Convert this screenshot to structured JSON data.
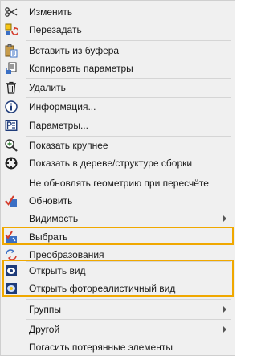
{
  "menu": {
    "accent_color": "#f0a800",
    "items": [
      {
        "label": "Изменить",
        "icon": "scissors-edit-icon"
      },
      {
        "label": "Перезадать",
        "icon": "redefine-icon"
      },
      {
        "label": "Вставить из буфера",
        "icon": "clipboard-paste-icon"
      },
      {
        "label": "Копировать параметры",
        "icon": "copy-params-icon"
      },
      {
        "label": "Удалить",
        "icon": "trash-icon"
      },
      {
        "label": "Информация...",
        "icon": "info-icon"
      },
      {
        "label": "Параметры...",
        "icon": "parameters-icon"
      },
      {
        "label": "Показать крупнее",
        "icon": "zoom-in-icon"
      },
      {
        "label": "Показать в дереве/структуре сборки",
        "icon": "crosshair-icon"
      },
      {
        "label": "Не обновлять геометрию при пересчёте",
        "icon": ""
      },
      {
        "label": "Обновить",
        "icon": "refresh-check-icon"
      },
      {
        "label": "Видимость",
        "icon": "",
        "submenu": true
      },
      {
        "label": "Выбрать",
        "icon": "select-icon"
      },
      {
        "label": "Преобразования",
        "icon": "transform-icon"
      },
      {
        "label": "Открыть вид",
        "icon": "open-view-icon"
      },
      {
        "label": "Открыть фотореалистичный вид",
        "icon": "photoreal-view-icon"
      },
      {
        "label": "Группы",
        "icon": "",
        "submenu": true
      },
      {
        "label": "Другой",
        "icon": "",
        "submenu": true
      },
      {
        "label": "Погасить потерянные элементы",
        "icon": ""
      }
    ]
  }
}
